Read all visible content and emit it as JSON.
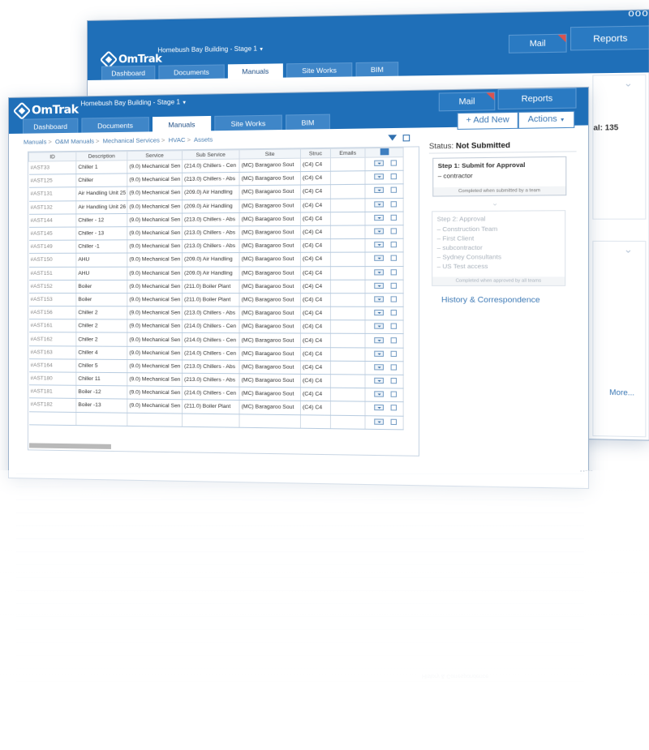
{
  "app": {
    "logo": "OmTrak",
    "project": "Homebush Bay Building - Stage 1",
    "more_dots": "ooo",
    "accent": "#1f6fb8"
  },
  "nav": {
    "tabs": [
      "Dashboard",
      "Documents",
      "Manuals",
      "Site Works",
      "BIM"
    ],
    "active": "Manuals",
    "mail": "Mail",
    "reports": "Reports"
  },
  "back": {
    "count_label": "al: 135",
    "more_link": "More..."
  },
  "breadcrumb": [
    "Manuals",
    "O&M Manuals",
    "Mechanical Services",
    "HVAC",
    "Assets"
  ],
  "toolbar": {
    "add_new": "+ Add New",
    "actions": "Actions"
  },
  "table": {
    "columns": [
      "ID",
      "Description",
      "Service",
      "Sub Service",
      "Site",
      "Struc",
      "Emails"
    ],
    "rows": [
      [
        "#AST33",
        "Chiller 1",
        "(9.0) Mechanical Sen",
        "(214.0) Chillers - Cen",
        "(MC) Baragaroo Sout",
        "(C4) C4"
      ],
      [
        "#AST125",
        "Chiller",
        "(9.0) Mechanical Sen",
        "(213.0) Chillers - Abs",
        "(MC) Baragaroo Sout",
        "(C4) C4"
      ],
      [
        "#AST131",
        "Air Handling Unit 25",
        "(9.0) Mechanical Sen",
        "(209.0) Air Handling",
        "(MC) Baragaroo Sout",
        "(C4) C4"
      ],
      [
        "#AST132",
        "Air Handling Unit 26",
        "(9.0) Mechanical Sen",
        "(209.0) Air Handling",
        "(MC) Baragaroo Sout",
        "(C4) C4"
      ],
      [
        "#AST144",
        "Chiller - 12",
        "(9.0) Mechanical Sen",
        "(213.0) Chillers - Abs",
        "(MC) Baragaroo Sout",
        "(C4) C4"
      ],
      [
        "#AST145",
        "Chiller - 13",
        "(9.0) Mechanical Sen",
        "(213.0) Chillers - Abs",
        "(MC) Baragaroo Sout",
        "(C4) C4"
      ],
      [
        "#AST149",
        "Chiller -1",
        "(9.0) Mechanical Sen",
        "(213.0) Chillers - Abs",
        "(MC) Baragaroo Sout",
        "(C4) C4"
      ],
      [
        "#AST150",
        "AHU",
        "(9.0) Mechanical Sen",
        "(209.0) Air Handling",
        "(MC) Baragaroo Sout",
        "(C4) C4"
      ],
      [
        "#AST151",
        "AHU",
        "(9.0) Mechanical Sen",
        "(209.0) Air Handling",
        "(MC) Baragaroo Sout",
        "(C4) C4"
      ],
      [
        "#AST152",
        "Boiler",
        "(9.0) Mechanical Sen",
        "(211.0) Boiler Plant",
        "(MC) Baragaroo Sout",
        "(C4) C4"
      ],
      [
        "#AST153",
        "Boiler",
        "(9.0) Mechanical Sen",
        "(211.0) Boiler Plant",
        "(MC) Baragaroo Sout",
        "(C4) C4"
      ],
      [
        "#AST156",
        "Chiller 2",
        "(9.0) Mechanical Sen",
        "(213.0) Chillers - Abs",
        "(MC) Baragaroo Sout",
        "(C4) C4"
      ],
      [
        "#AST161",
        "Chiller 2",
        "(9.0) Mechanical Sen",
        "(214.0) Chillers - Cen",
        "(MC) Baragaroo Sout",
        "(C4) C4"
      ],
      [
        "#AST162",
        "Chiller 2",
        "(9.0) Mechanical Sen",
        "(214.0) Chillers - Cen",
        "(MC) Baragaroo Sout",
        "(C4) C4"
      ],
      [
        "#AST163",
        "Chiller 4",
        "(9.0) Mechanical Sen",
        "(214.0) Chillers - Cen",
        "(MC) Baragaroo Sout",
        "(C4) C4"
      ],
      [
        "#AST164",
        "Chiller 5",
        "(9.0) Mechanical Sen",
        "(213.0) Chillers - Abs",
        "(MC) Baragaroo Sout",
        "(C4) C4"
      ],
      [
        "#AST180",
        "Chiller 11",
        "(9.0) Mechanical Sen",
        "(213.0) Chillers - Abs",
        "(MC) Baragaroo Sout",
        "(C4) C4"
      ],
      [
        "#AST181",
        "Boiler -12",
        "(9.0) Mechanical Sen",
        "(214.0) Chillers - Cen",
        "(MC) Baragaroo Sout",
        "(C4) C4"
      ],
      [
        "#AST182",
        "Boiler -13",
        "(9.0) Mechanical Sen",
        "(211.0) Boiler Plant",
        "(MC) Baragaroo Sout",
        "(C4) C4"
      ],
      [
        "",
        "",
        "",
        "",
        "",
        ""
      ]
    ]
  },
  "workflow": {
    "status_label": "Status:",
    "status_value": "Not Submitted",
    "step1": {
      "title": "Step 1: Submit for Approval",
      "items": [
        "contractor"
      ],
      "footer": "Completed when submitted by a team"
    },
    "step2": {
      "title": "Step 2: Approval",
      "items": [
        "Construction Team",
        "First Client",
        "subcontractor",
        "Sydney Consultants",
        "US Test access"
      ],
      "footer": "Completed when approved by all teams"
    },
    "history_link": "History & Correspondence"
  }
}
